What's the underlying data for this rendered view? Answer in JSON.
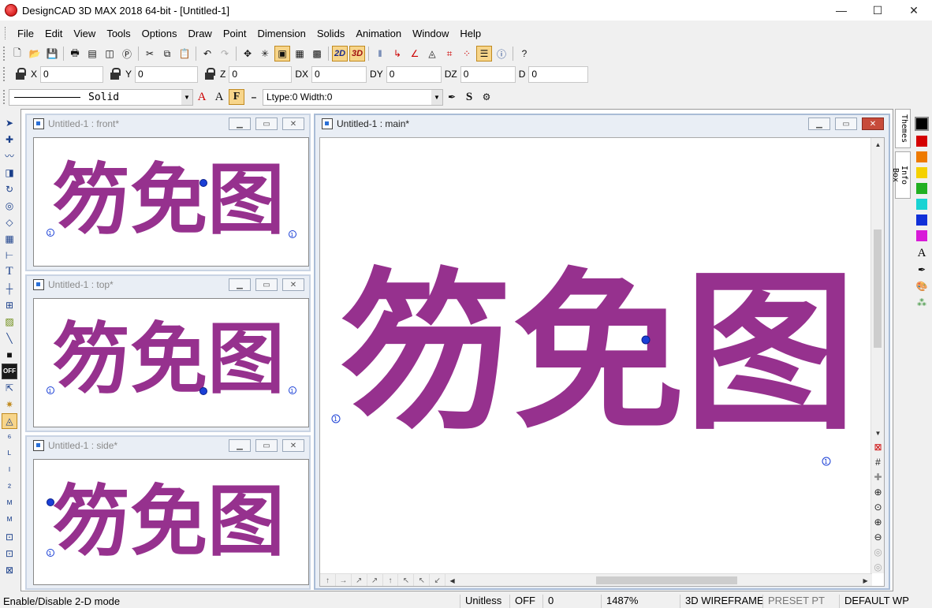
{
  "window": {
    "title": "DesignCAD 3D MAX 2018 64-bit - [Untitled-1]",
    "controls": {
      "minimize": "—",
      "maximize": "☐",
      "close": "✕"
    }
  },
  "menu": [
    "File",
    "Edit",
    "View",
    "Tools",
    "Options",
    "Draw",
    "Point",
    "Dimension",
    "Solids",
    "Animation",
    "Window",
    "Help"
  ],
  "toolbar": {
    "mode_2d": "2D",
    "mode_3d": "3D"
  },
  "coords": {
    "x": {
      "label": "X",
      "value": "0"
    },
    "y": {
      "label": "Y",
      "value": "0"
    },
    "z": {
      "label": "Z",
      "value": "0"
    },
    "dx": {
      "label": "DX",
      "value": "0"
    },
    "dy": {
      "label": "DY",
      "value": "0"
    },
    "dz": {
      "label": "DZ",
      "value": "0"
    },
    "d": {
      "label": "D",
      "value": "0"
    }
  },
  "line_style": {
    "style": "Solid",
    "font_a1": "A",
    "font_a2": "A",
    "f_button": "F",
    "dash": "–",
    "ltype_text": "Ltype:0  Width:0",
    "s_button": "S"
  },
  "left_tools": {
    "off_label": "OFF"
  },
  "views": {
    "front": "Untitled-1 : front*",
    "top": "Untitled-1 : top*",
    "side": "Untitled-1 : side*",
    "main": "Untitled-1 : main*"
  },
  "drawing": {
    "glyphs": "笏免图",
    "stroke_color": "#96318e",
    "point_marker_label": "1"
  },
  "right_tabs": [
    "Themes",
    "Info Box"
  ],
  "palette": {
    "current": "#000000",
    "colors": [
      "#d40000",
      "#ee7a00",
      "#f5d100",
      "#21b021",
      "#19d3d3",
      "#1030d8",
      "#d81ad8"
    ]
  },
  "status": {
    "message": "Enable/Disable 2-D mode",
    "units": "Unitless",
    "snap": "OFF",
    "value": "0",
    "zoom": "1487%",
    "render_mode": "3D WIREFRAME",
    "preset": "PRESET PT",
    "workplane": "DEFAULT WP"
  }
}
